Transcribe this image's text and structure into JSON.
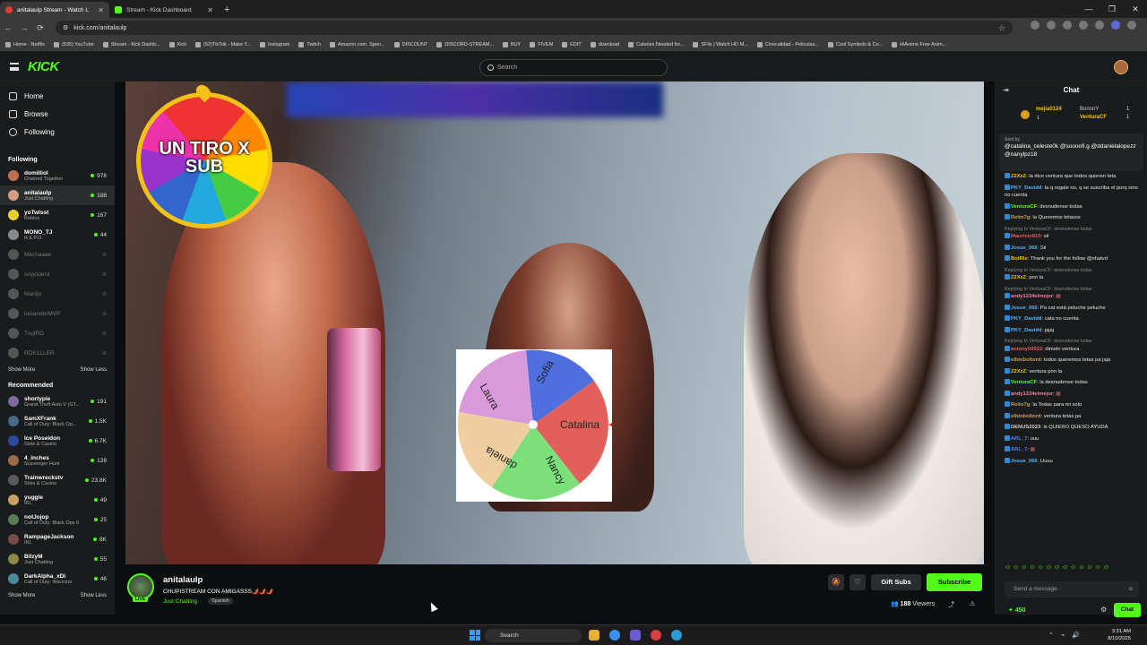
{
  "browser": {
    "tabs": [
      {
        "title": "anitalaulp Stream - Watch L",
        "active": true
      },
      {
        "title": "Stream - Kick Dashboard",
        "active": false
      }
    ],
    "url": "kick.com/anitalaulp",
    "bookmarks": [
      "Home - Netflix",
      "(535) YouTube",
      "Stream - Kick Dashb...",
      "Kick",
      "(52)TikTok - Make Y...",
      "Instagram",
      "Twitch",
      "Amazon.com. Spen...",
      "DISCOUNT",
      "DISCORD-STREAM...",
      "BUY",
      "FIVEM",
      "EDIT",
      "download",
      "Calories Needed for...",
      "SFlix | Watch HD M...",
      "Cinecalidad - Peliculas...",
      "Cool Symbols & Co...",
      "HiAnime Free Anim..."
    ]
  },
  "header": {
    "logo": "KICK",
    "search_placeholder": "Search"
  },
  "sidebar": {
    "nav": [
      {
        "label": "Home",
        "icon": "home-icon"
      },
      {
        "label": "Browse",
        "icon": "browse-icon"
      },
      {
        "label": "Following",
        "icon": "heart-icon"
      }
    ],
    "following_title": "Following",
    "following": [
      {
        "name": "domilliol",
        "game": "Chained Together",
        "viewers": "978",
        "live": true
      },
      {
        "name": "anitalaulp",
        "game": "Just Chatting",
        "viewers": "188",
        "live": true
      },
      {
        "name": "yoTwisst",
        "game": "Roblox",
        "viewers": "167",
        "live": true
      },
      {
        "name": "MONO_TJ",
        "game": "R.E.P.O.",
        "viewers": "44",
        "live": true
      },
      {
        "name": "Mechaaax",
        "game": "",
        "viewers": "",
        "live": false
      },
      {
        "name": "soyjoderd",
        "game": "",
        "viewers": "",
        "live": false
      },
      {
        "name": "Marlijo",
        "game": "",
        "viewers": "",
        "live": false
      },
      {
        "name": "luisanderMVP",
        "game": "",
        "viewers": "",
        "live": false
      },
      {
        "name": "TrujiRD",
        "game": "",
        "viewers": "",
        "live": false
      },
      {
        "name": "RDK1LLER",
        "game": "",
        "viewers": "",
        "live": false
      }
    ],
    "show_more": "Show More",
    "show_less": "Show Less",
    "recommended_title": "Recommended",
    "recommended": [
      {
        "name": "shortypie",
        "game": "Grand Theft Auto V (GT...",
        "viewers": "191"
      },
      {
        "name": "SamXFrank",
        "game": "Call of Duty: Black Op...",
        "viewers": "1.5K"
      },
      {
        "name": "Ice Poseidon",
        "game": "Slots & Casino",
        "viewers": "6.7K"
      },
      {
        "name": "4_inches",
        "game": "Scavenger Hunt",
        "viewers": "128"
      },
      {
        "name": "Trainwreckstv",
        "game": "Slots & Casino",
        "viewers": "23.8K"
      },
      {
        "name": "yuggie",
        "game": "IRL",
        "viewers": "49"
      },
      {
        "name": "notJojop",
        "game": "Call of Duty: Black Ops 6",
        "viewers": "25"
      },
      {
        "name": "RampageJackson",
        "game": "IRL",
        "viewers": "8K"
      },
      {
        "name": "BilzyM",
        "game": "Just Chatting",
        "viewers": "55"
      },
      {
        "name": "DarkAlpha_xDi",
        "game": "Call of Duty: Warzone",
        "viewers": "46"
      }
    ]
  },
  "video": {
    "overlay_wheel_text": "UN TIRO X SUB",
    "wheel_names": [
      "Sofia",
      "Catalina",
      "Nancy",
      "daniela",
      "Laura"
    ]
  },
  "stream": {
    "streamer": "anitalaulp",
    "title": "CHUPISTREAM CON AMIGASSS🌶️🌶️🌶️",
    "category": "Just Chatting",
    "language": "Spanish",
    "live_badge": "LIVE",
    "gift_subs": "Gift Subs",
    "subscribe": "Subscribe",
    "viewers": "188",
    "viewers_label": "Viewers"
  },
  "chat": {
    "title": "Chat",
    "top_gifters": [
      {
        "name": "mejia0124",
        "count": "1"
      },
      {
        "name": "BonnnY",
        "count": "1"
      },
      {
        "name": "VenturaCF",
        "count": "1"
      }
    ],
    "pinned_label": "Sent by",
    "pinned_text": "@catalina_celeste0k @sooooﬁ.g @ddanielalopezz @nanylpz18",
    "messages": [
      {
        "user": "Z2XzZ",
        "color": "#f0c000",
        "text": "la dice ventura que todos quieren teta",
        "reply": ""
      },
      {
        "user": "PKY_Davidd",
        "color": "#5ab0f0",
        "text": "la q regale no, q se suscriba el porq sino no cuenta",
        "reply": ""
      },
      {
        "user": "VenturaCF",
        "color": "#53fc18",
        "text": "desnudense todas",
        "reply": ""
      },
      {
        "user": "Reito7g",
        "color": "#c8a060",
        "text": "la Queremos tetasss",
        "reply": ""
      },
      {
        "user": "Mauricio810",
        "color": "#e06060",
        "text": "sii",
        "reply": "Replying to VenturaCF: desnudense todas"
      },
      {
        "user": "Josue_066",
        "color": "#5ab0f0",
        "text": "Sii",
        "reply": ""
      },
      {
        "user": "BotRix",
        "color": "#f0c000",
        "text": "Thank you for the follow @shatvd",
        "reply": ""
      },
      {
        "user": "Z2XzZ",
        "color": "#f0c000",
        "text": "pon la",
        "reply": "Replying to VenturaCF: desnudense todas"
      },
      {
        "user": "andy1234elmejor",
        "color": "#f080a0",
        "text": "",
        "reply": "Replying to VenturaCF: desnudense todas"
      },
      {
        "user": "Josue_066",
        "color": "#5ab0f0",
        "text": "Pa cat está peluche peluche",
        "reply": ""
      },
      {
        "user": "PKY_Davidd",
        "color": "#5ab0f0",
        "text": "cata no cuenta",
        "reply": ""
      },
      {
        "user": "PKY_Davidd",
        "color": "#5ab0f0",
        "text": "jajaj",
        "reply": ""
      },
      {
        "user": "antony00022",
        "color": "#e06060",
        "text": "dimelo ventura",
        "reply": "Replying to VenturaCF: desnudense todas"
      },
      {
        "user": "elbinboltord",
        "color": "#c8a060",
        "text": "todos queremos tetas pa jaja",
        "reply": ""
      },
      {
        "user": "Z2XzZ",
        "color": "#f0c000",
        "text": "ventura pon la",
        "reply": ""
      },
      {
        "user": "VenturaCF",
        "color": "#53fc18",
        "text": "la desnudense todas",
        "reply": ""
      },
      {
        "user": "andy1234elmejor",
        "color": "#f080a0",
        "text": "",
        "reply": ""
      },
      {
        "user": "Reito7g",
        "color": "#c8a060",
        "text": "la Todas para mi solo",
        "reply": ""
      },
      {
        "user": "elbinboltord",
        "color": "#c8a060",
        "text": "ventura tetas pa",
        "reply": ""
      },
      {
        "user": "DENUS2023",
        "color": "#d0d0d0",
        "text": "ls QUIERO QUESO AYUDA",
        "reply": ""
      },
      {
        "user": "ARL_7",
        "color": "#5a7af0",
        "text": "uuu",
        "reply": ""
      },
      {
        "user": "ARL_7",
        "color": "#5a7af0",
        "text": "",
        "reply": ""
      },
      {
        "user": "Josue_066",
        "color": "#5ab0f0",
        "text": "Uuuu",
        "reply": ""
      }
    ],
    "input_placeholder": "Send a message",
    "points": "450",
    "chat_button": "Chat"
  },
  "taskbar": {
    "search": "Search",
    "time": "3:31 AM",
    "date": "8/10/2025"
  },
  "colors": {
    "accent": "#53fc18",
    "bg": "#0b0e0f",
    "panel": "#191b1c"
  }
}
